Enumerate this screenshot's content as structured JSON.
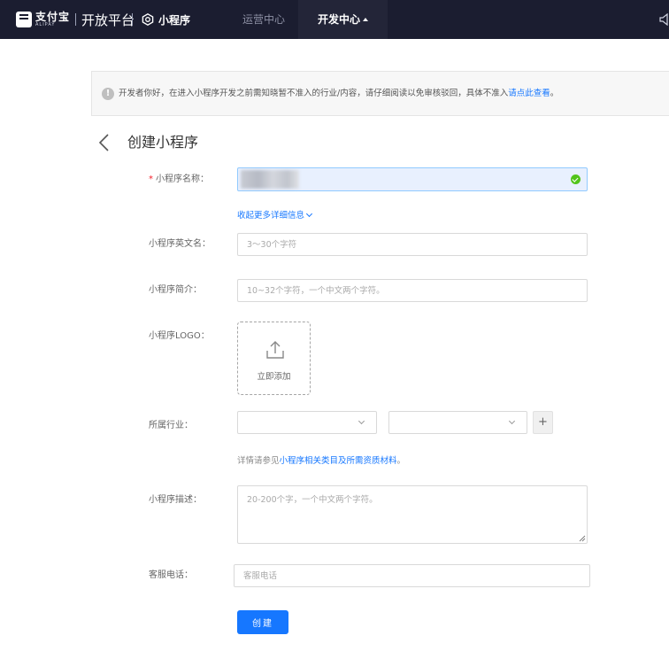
{
  "nav": {
    "brand_cn": "支付宝",
    "brand_en": "ALIPAY",
    "platform": "开放平台",
    "product": "小程序",
    "menu_ops": "运营中心",
    "menu_dev": "开发中心"
  },
  "notice": {
    "text": "开发者你好，在进入小程序开发之前需知晓暂不准入的行业/内容，请仔细阅读以免审核驳回，具体不准入",
    "link": "请点此查看",
    "suffix": "。"
  },
  "page": {
    "title": "创建小程序"
  },
  "form": {
    "name_label": "小程序名称：",
    "required_mark": "*",
    "name_value": "",
    "collapse_link": "收起更多详细信息",
    "en_name_label": "小程序英文名：",
    "en_name_placeholder": "3～30个字符",
    "intro_label": "小程序简介：",
    "intro_placeholder": "10~32个字符，一个中文两个字符。",
    "logo_label": "小程序LOGO：",
    "upload_text": "立即添加",
    "industry_label": "所属行业：",
    "industry_primary": "",
    "industry_secondary": "",
    "add_symbol": "+",
    "hint_prefix": "详情请参见",
    "hint_link": "小程序相关类目及所需资质材料",
    "hint_suffix": "。",
    "desc_label": "小程序描述：",
    "desc_placeholder": "20-200个字，一个中文两个字符。",
    "phone_label": "客服电话：",
    "phone_placeholder": "客服电话",
    "submit_label": "创建"
  },
  "colors": {
    "nav_bg": "#1b1d30",
    "primary": "#1677ff",
    "success": "#52c41a",
    "required": "#f5222d"
  },
  "icons": {
    "back": "chevron-left-icon",
    "upload": "upload-icon",
    "success": "check-circle-icon",
    "info": "info-icon",
    "speaker": "speaker-icon"
  }
}
